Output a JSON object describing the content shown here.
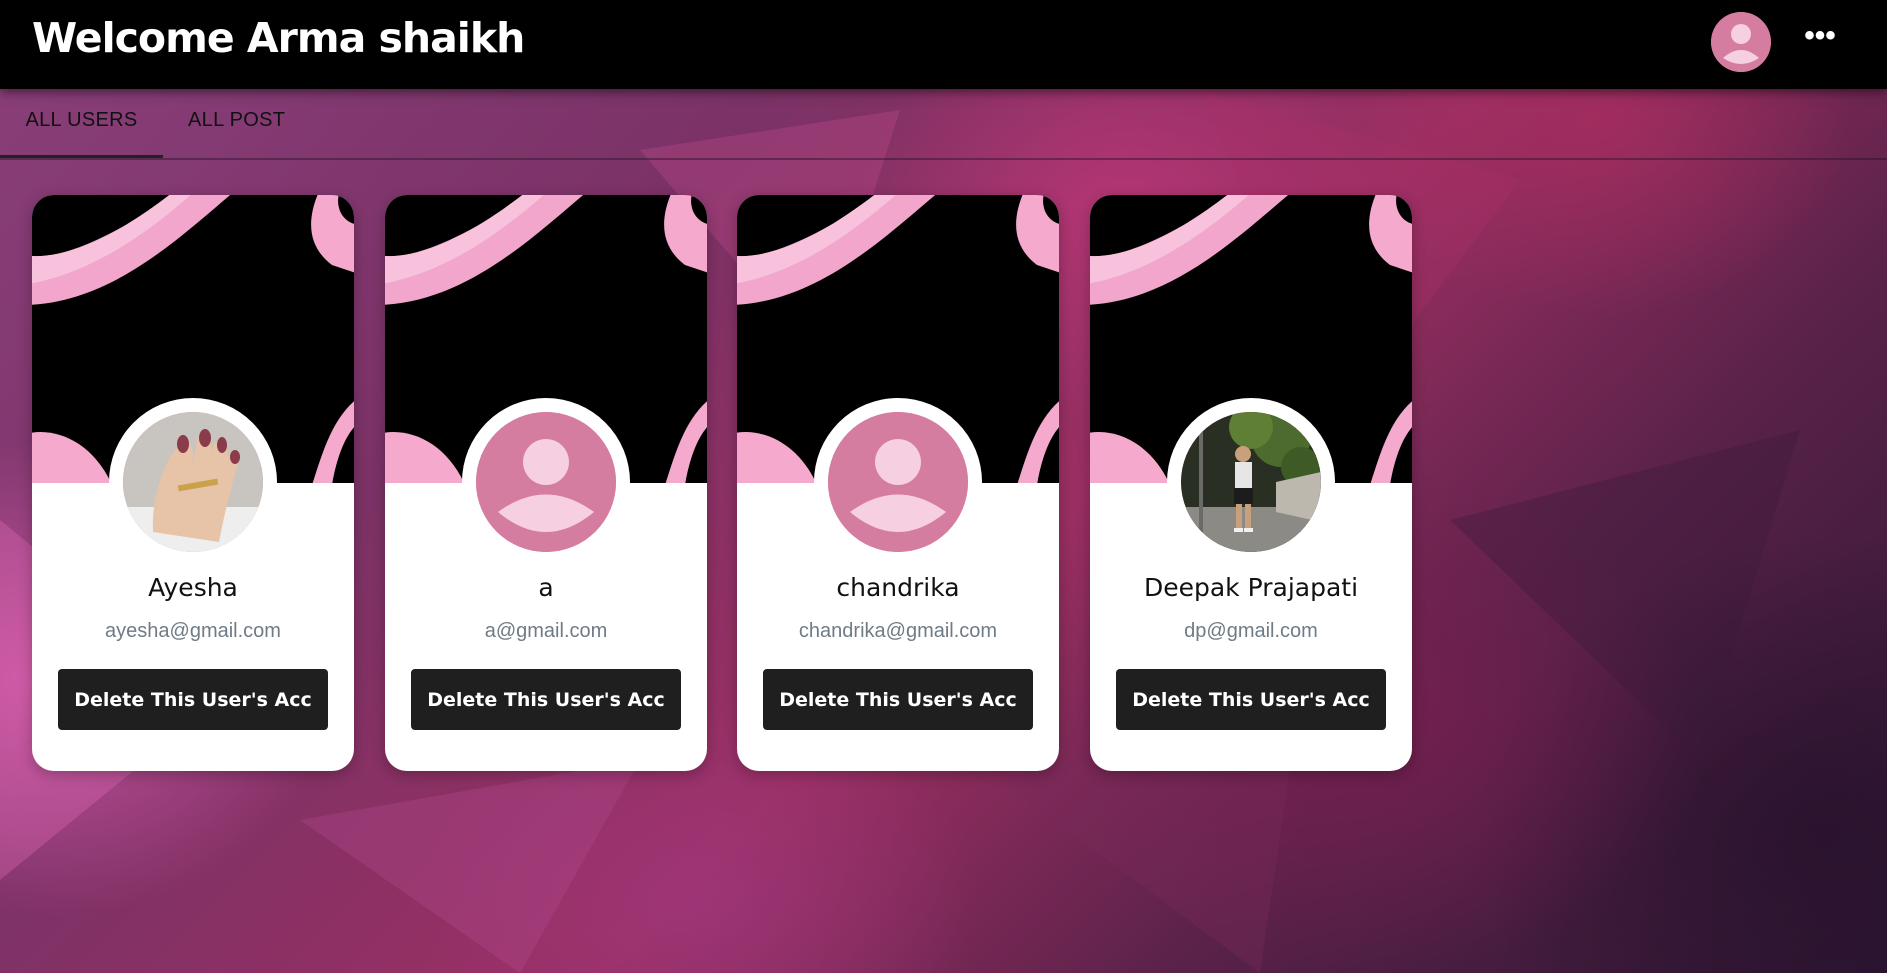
{
  "header": {
    "title": "Welcome Arma shaikh",
    "avatar_icon": "user-avatar-icon",
    "menu_icon": "more-horizontal-icon",
    "menu_glyph": "•••"
  },
  "tabs": [
    {
      "label": "ALL USERS",
      "active": true
    },
    {
      "label": "ALL POST",
      "active": false
    }
  ],
  "users": [
    {
      "name": "Ayesha",
      "email": "ayesha@gmail.com",
      "delete_label": "Delete This User's Acc",
      "photo": "manicured-hand-photo"
    },
    {
      "name": "a",
      "email": "a@gmail.com",
      "delete_label": "Delete This User's Acc",
      "photo": "default-avatar-icon"
    },
    {
      "name": "chandrika",
      "email": "chandrika@gmail.com",
      "delete_label": "Delete This User's Acc",
      "photo": "default-avatar-icon"
    },
    {
      "name": "Deepak Prajapati",
      "email": "dp@gmail.com",
      "delete_label": "Delete This User's Acc",
      "photo": "person-street-photo"
    }
  ],
  "colors": {
    "accent_pink": "#d57da0",
    "avatar_light": "#f6cfe0",
    "button_dark": "#1f1f1f",
    "email_gray": "#6f7b86"
  }
}
